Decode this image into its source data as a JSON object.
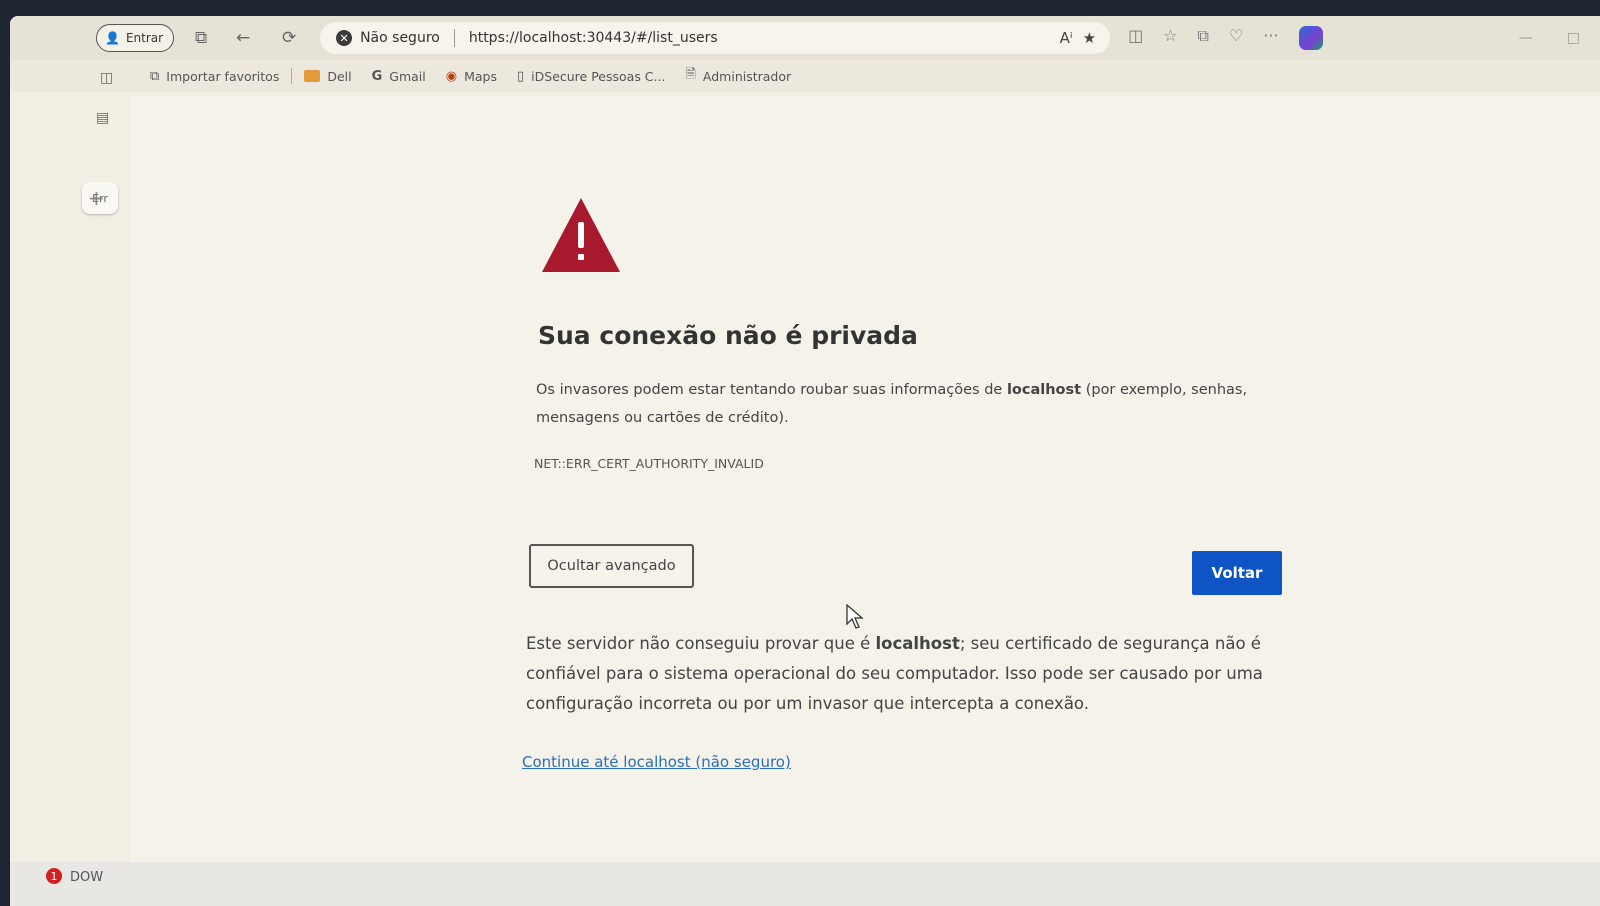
{
  "browser": {
    "profile_label": "Entrar",
    "security_label": "Não seguro",
    "url": "https://localhost:30443/#/list_users",
    "more_label": "···"
  },
  "bookmarks": [
    {
      "label": "Importar favoritos",
      "icon": "import-icon"
    },
    {
      "label": "Dell",
      "icon": "folder-icon"
    },
    {
      "label": "Gmail",
      "icon": "google-icon"
    },
    {
      "label": "Maps",
      "icon": "map-pin-icon"
    },
    {
      "label": "iDSecure Pessoas C...",
      "icon": "id-icon"
    },
    {
      "label": "Administrador",
      "icon": "page-icon"
    }
  ],
  "sidebar": {
    "tab_label": "Err"
  },
  "error_page": {
    "title": "Sua conexão não é privada",
    "para1_a": "Os invasores podem estar tentando roubar suas informações de ",
    "para1_host": "localhost",
    "para1_b": " (por exemplo, senhas, mensagens ou cartões de crédito).",
    "error_code": "NET::ERR_CERT_AUTHORITY_INVALID",
    "advanced_button": "Ocultar avançado",
    "back_button": "Voltar",
    "para2_a": "Este servidor não conseguiu provar que é ",
    "para2_host": "localhost",
    "para2_b": "; seu certificado de segurança não é confiável para o sistema operacional do seu computador. Isso pode ser causado por uma configuração incorreta ou por um invasor que intercepta a conexão.",
    "proceed_link": "Continue até localhost (não seguro)",
    "warning_color": "#a8192e",
    "button_color": "#0f54c5"
  },
  "taskbar": {
    "notification_count": "1",
    "label": "DOW"
  }
}
